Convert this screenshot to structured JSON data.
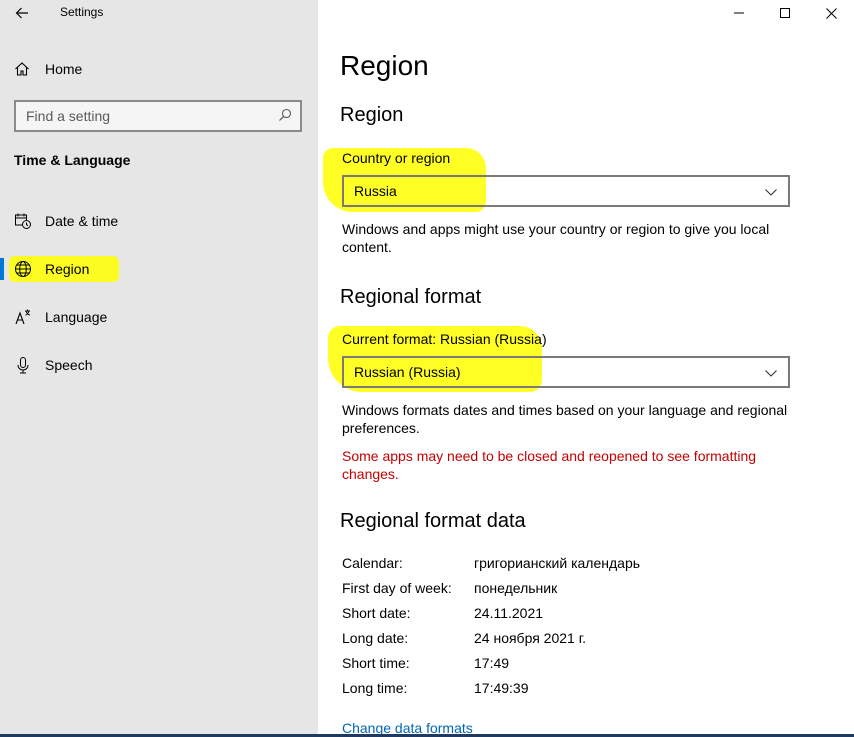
{
  "window": {
    "title": "Settings"
  },
  "sidebar": {
    "home_label": "Home",
    "search_placeholder": "Find a setting",
    "section_label": "Time & Language",
    "items": [
      {
        "label": "Date & time",
        "icon": "calendar-clock-icon"
      },
      {
        "label": "Region",
        "icon": "globe-icon",
        "active": true
      },
      {
        "label": "Language",
        "icon": "language-icon"
      },
      {
        "label": "Speech",
        "icon": "microphone-icon"
      }
    ]
  },
  "main": {
    "page_title": "Region",
    "region_heading": "Region",
    "country_label": "Country or region",
    "country_value": "Russia",
    "country_desc": "Windows and apps might use your country or region to give you local content.",
    "format_heading": "Regional format",
    "current_format_label": "Current format: Russian (Russia)",
    "format_value": "Russian (Russia)",
    "format_desc": "Windows formats dates and times based on your language and regional preferences.",
    "format_warning": "Some apps may need to be closed and reopened to see formatting changes.",
    "format_data_heading": "Regional format data",
    "format_data": [
      {
        "key": "Calendar:",
        "value": "григорианский календарь"
      },
      {
        "key": "First day of week:",
        "value": "понедельник"
      },
      {
        "key": "Short date:",
        "value": "24.11.2021"
      },
      {
        "key": "Long date:",
        "value": "24 ноября 2021 г."
      },
      {
        "key": "Short time:",
        "value": "17:49"
      },
      {
        "key": "Long time:",
        "value": "17:49:39"
      }
    ],
    "change_link": "Change data formats"
  },
  "colors": {
    "accent": "#0078d7",
    "highlight": "#ffff00",
    "warning": "#c50000",
    "link": "#0066b4"
  }
}
